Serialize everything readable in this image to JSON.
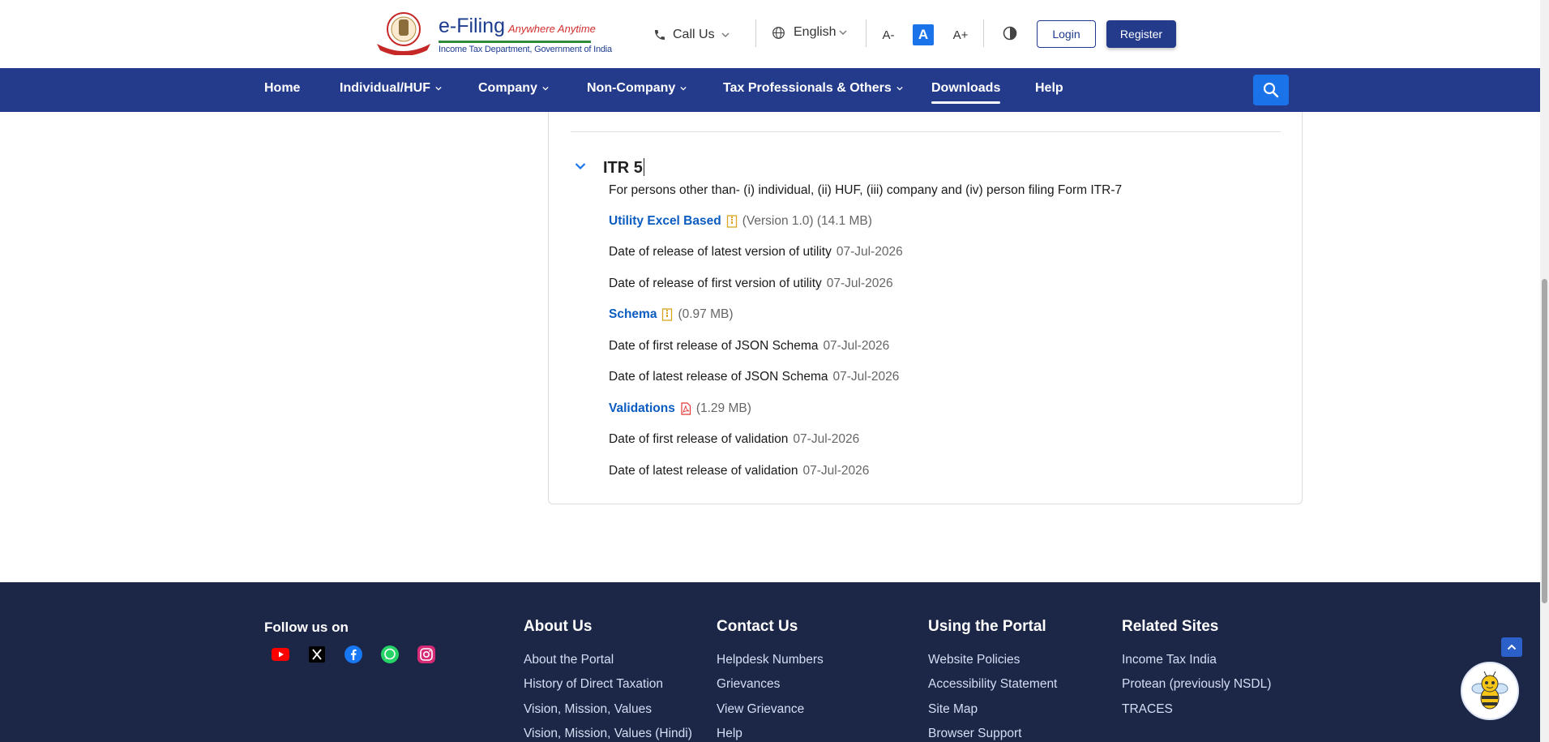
{
  "header": {
    "brand_title": "e-Filing",
    "brand_tagline": "Anywhere Anytime",
    "brand_subtitle": "Income Tax Department, Government of India",
    "call_us": "Call Us",
    "language": "English",
    "font_decrease": "A-",
    "font_normal": "A",
    "font_increase": "A+",
    "login": "Login",
    "register": "Register"
  },
  "nav": {
    "items": [
      {
        "label": "Home"
      },
      {
        "label": "Individual/HUF"
      },
      {
        "label": "Company"
      },
      {
        "label": "Non-Company"
      },
      {
        "label": "Tax Professionals & Others"
      },
      {
        "label": "Downloads"
      },
      {
        "label": "Help"
      }
    ],
    "active": "Downloads"
  },
  "itr": {
    "title": "ITR 5",
    "description": "For persons other than- (i) individual, (ii) HUF, (iii) company and (iv) person filing Form ITR-7",
    "utility_link": "Utility Excel Based",
    "utility_meta": "(Version 1.0) (14.1 MB)",
    "utility_latest_label": "Date of release of latest version of utility",
    "utility_latest_date": "07-Jul-2026",
    "utility_first_label": "Date of release of first version of utility",
    "utility_first_date": "07-Jul-2026",
    "schema_link": "Schema",
    "schema_meta": "(0.97 MB)",
    "schema_first_label": "Date of first release of JSON Schema",
    "schema_first_date": "07-Jul-2026",
    "schema_latest_label": "Date of latest release of JSON Schema",
    "schema_latest_date": "07-Jul-2026",
    "validations_link": "Validations",
    "validations_meta": "(1.29 MB)",
    "validation_first_label": "Date of first release of validation",
    "validation_first_date": "07-Jul-2026",
    "validation_latest_label": "Date of latest release of validation",
    "validation_latest_date": "07-Jul-2026"
  },
  "footer": {
    "follow_us": "Follow us on",
    "social": [
      "youtube-icon",
      "x-icon",
      "facebook-icon",
      "whatsapp-icon",
      "instagram-icon"
    ],
    "about": {
      "title": "About Us",
      "links": [
        "About the Portal",
        "History of Direct Taxation",
        "Vision, Mission, Values",
        "Vision, Mission, Values (Hindi)"
      ]
    },
    "contact": {
      "title": "Contact Us",
      "links": [
        "Helpdesk Numbers",
        "Grievances",
        "View Grievance",
        "Help"
      ]
    },
    "portal": {
      "title": "Using the Portal",
      "links": [
        "Website Policies",
        "Accessibility Statement",
        "Site Map",
        "Browser Support"
      ]
    },
    "related": {
      "title": "Related Sites",
      "links": [
        "Income Tax India",
        "Protean (previously NSDL)",
        "TRACES"
      ]
    }
  },
  "colors": {
    "nav_bg": "#243b8c",
    "footer_bg": "#1c2747",
    "link": "#0b5cc1",
    "accent": "#1a73e8"
  }
}
